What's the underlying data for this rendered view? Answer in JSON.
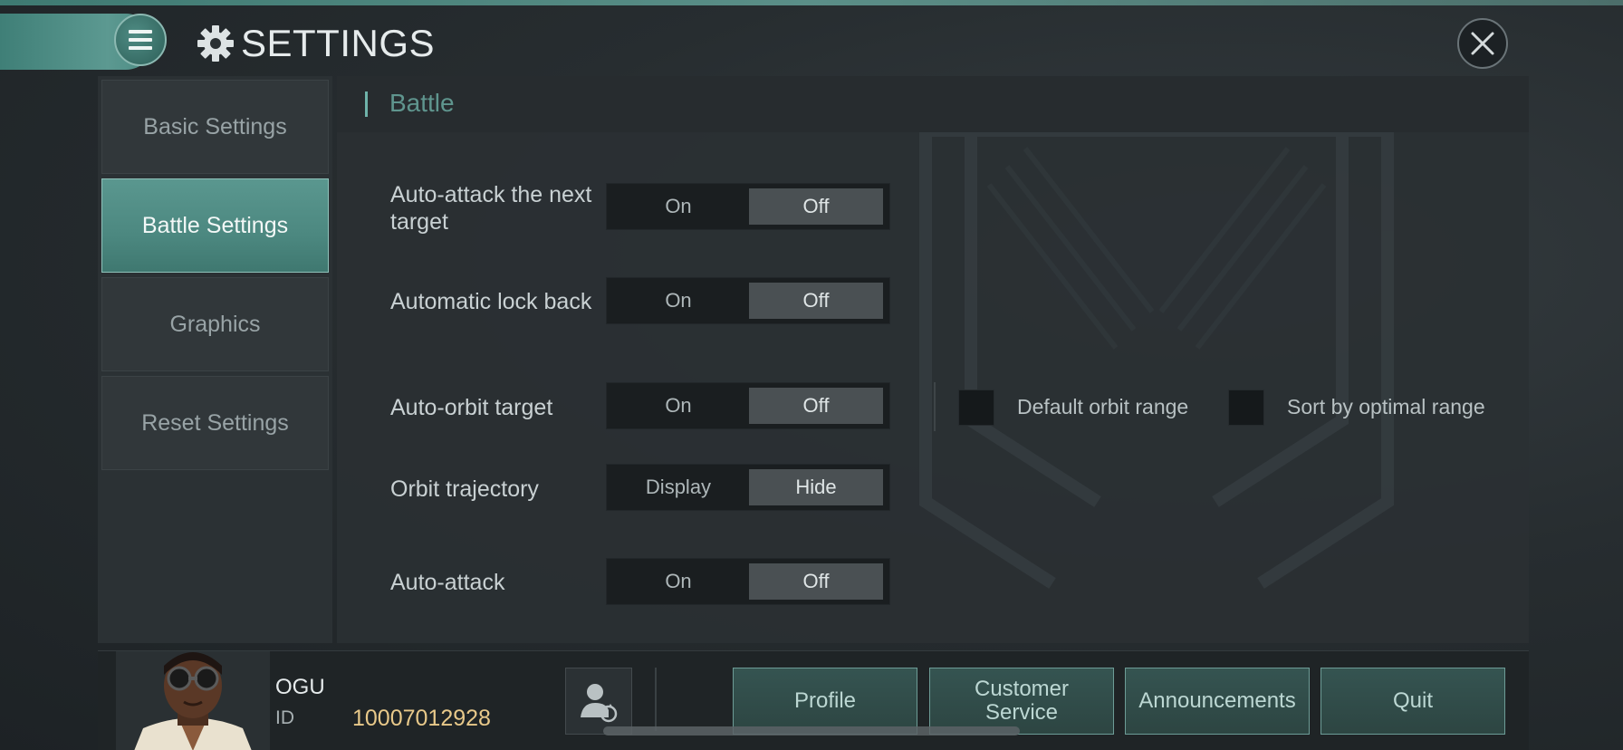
{
  "header": {
    "title": "SETTINGS",
    "menu_icon": "hamburger-menu-icon",
    "title_icon": "gear-icon",
    "close_icon": "close-icon"
  },
  "sidebar": {
    "items": [
      {
        "label": "Basic Settings",
        "active": false
      },
      {
        "label": "Battle Settings",
        "active": true
      },
      {
        "label": "Graphics",
        "active": false
      },
      {
        "label": "Reset Settings",
        "active": false
      }
    ]
  },
  "main": {
    "section_title": "Battle",
    "settings": [
      {
        "label": "Auto-attack the next target",
        "option_a": "On",
        "option_b": "Off",
        "selected": "Off"
      },
      {
        "label": "Automatic lock back",
        "option_a": "On",
        "option_b": "Off",
        "selected": "Off"
      },
      {
        "label": "Auto-orbit target",
        "option_a": "On",
        "option_b": "Off",
        "selected": "Off"
      },
      {
        "label": "Orbit trajectory",
        "option_a": "Display",
        "option_b": "Hide",
        "selected": "Hide"
      },
      {
        "label": "Auto-attack",
        "option_a": "On",
        "option_b": "Off",
        "selected": "Off"
      }
    ],
    "orbit_options": [
      {
        "label": "Default orbit range",
        "checked": false
      },
      {
        "label": "Sort by optimal range",
        "checked": false
      }
    ]
  },
  "footer": {
    "player_name": "OGU",
    "id_label": "ID",
    "id_value": "10007012928",
    "switch_icon": "switch-account-icon",
    "buttons": [
      {
        "label": "Profile"
      },
      {
        "label": "Customer Service"
      },
      {
        "label": "Announcements"
      },
      {
        "label": "Quit"
      }
    ]
  },
  "colors": {
    "accent": "#5a978f",
    "id_value": "#e8c98a",
    "section_title": "#5f958e"
  }
}
